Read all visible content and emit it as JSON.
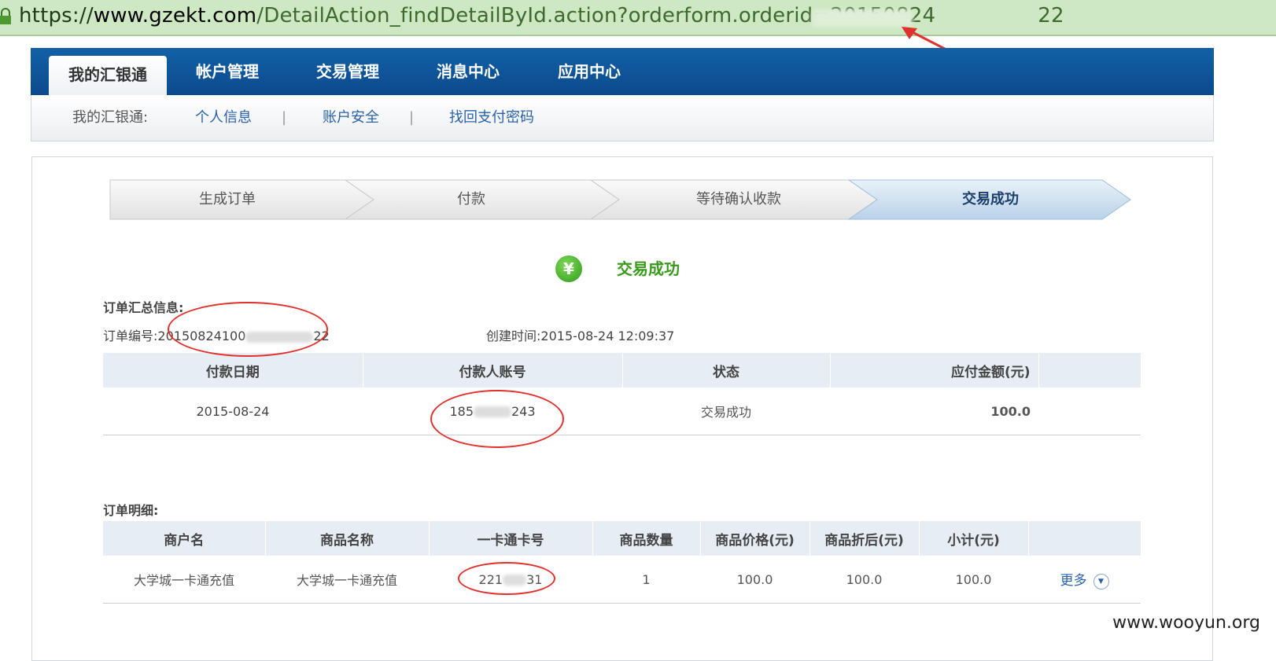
{
  "address_bar": {
    "scheme": "https://",
    "host": "www.gzekt.com",
    "path_prefix": "/DetailAction_findDetailById.action?orderform.orderid=20150824",
    "path_suffix": "22"
  },
  "top_nav": {
    "tabs": [
      "我的汇银通",
      "帐户管理",
      "交易管理",
      "消息中心",
      "应用中心"
    ],
    "active_index": 0
  },
  "sub_nav": {
    "label": "我的汇银通:",
    "items": [
      "个人信息",
      "账户安全",
      "找回支付密码"
    ],
    "separator": "|"
  },
  "steps": [
    "生成订单",
    "付款",
    "等待确认收款",
    "交易成功"
  ],
  "status": {
    "icon_glyph": "¥",
    "text": "交易成功"
  },
  "summary": {
    "heading": "订单汇总信息:",
    "order_no_label": "订单编号:",
    "order_no_prefix": "20150824100",
    "order_no_suffix": "22",
    "created_label": "创建时间:",
    "created_value": "2015-08-24 12:09:37",
    "table": {
      "headers": [
        "付款日期",
        "付款人账号",
        "状态",
        "应付金额(元)"
      ],
      "row": {
        "date": "2015-08-24",
        "account_prefix": "185",
        "account_suffix": "243",
        "status": "交易成功",
        "amount": "100.0"
      }
    }
  },
  "detail": {
    "heading": "订单明细:",
    "table": {
      "headers": [
        "商户名",
        "商品名称",
        "一卡通卡号",
        "商品数量",
        "商品价格(元)",
        "商品折后(元)",
        "小计(元)"
      ],
      "row": {
        "merchant": "大学城一卡通充值",
        "product": "大学城一卡通充值",
        "card_prefix": "221",
        "card_suffix": "31",
        "quantity": "1",
        "price": "100.0",
        "discounted": "100.0",
        "subtotal": "100.0",
        "more_label": "更多"
      }
    }
  },
  "watermark": "www.wooyun.org",
  "colors": {
    "nav_blue": "#0c4e93",
    "link_blue": "#2a62a9",
    "success_green": "#3a9a1c",
    "amount_orange": "#e0860f",
    "annotation_red": "#e2302c",
    "address_green": "#cde8c2"
  }
}
